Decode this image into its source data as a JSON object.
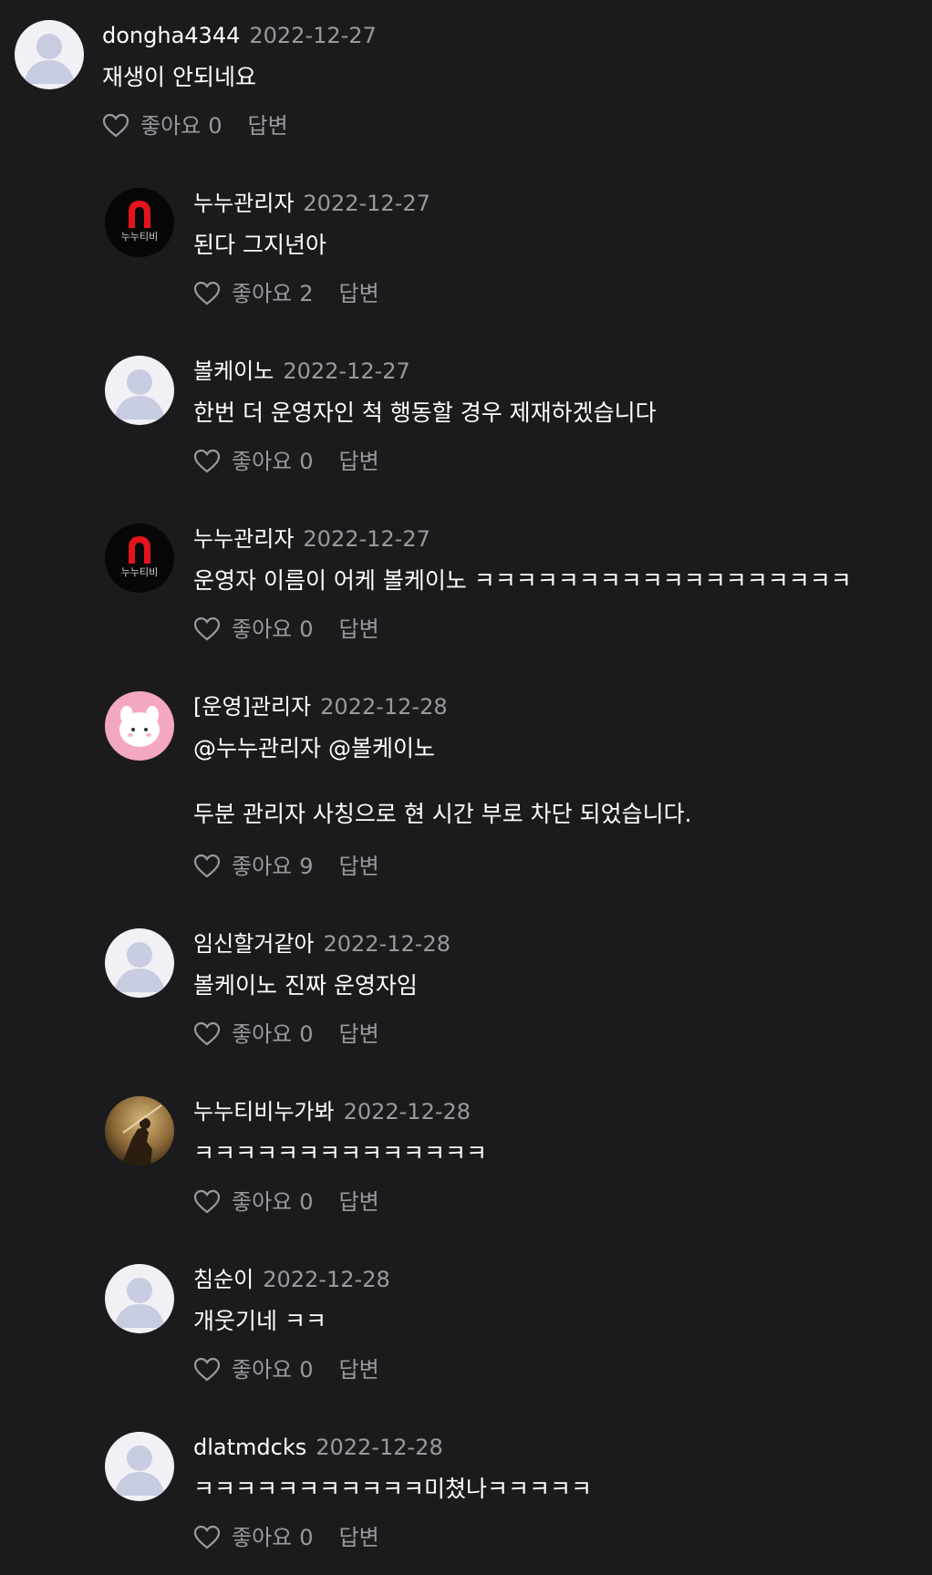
{
  "comments": [
    {
      "author": "dongha4344",
      "date": "2022-12-27",
      "text": "재생이 안되네요",
      "like_label": "좋아요",
      "like_count": "0",
      "reply_label": "답변",
      "avatar": "default-avatar"
    },
    {
      "author": "누누관리자",
      "date": "2022-12-27",
      "text": "된다 그지년아",
      "like_label": "좋아요",
      "like_count": "2",
      "reply_label": "답변",
      "avatar": "nunutv-logo-avatar",
      "logo_text": "누누티비"
    },
    {
      "author": "볼케이노",
      "date": "2022-12-27",
      "text": "한번 더 운영자인 척 행동할 경우 제재하겠습니다",
      "like_label": "좋아요",
      "like_count": "0",
      "reply_label": "답변",
      "avatar": "default-avatar"
    },
    {
      "author": "누누관리자",
      "date": "2022-12-27",
      "text": "운영자 이름이 어케 볼케이노 ㅋㅋㅋㅋㅋㅋㅋㅋㅋㅋㅋㅋㅋㅋㅋㅋㅋㅋ",
      "like_label": "좋아요",
      "like_count": "0",
      "reply_label": "답변",
      "avatar": "nunutv-logo-avatar",
      "logo_text": "누누티비"
    },
    {
      "author": "[운영]관리자",
      "date": "2022-12-28",
      "text": "@누누관리자 @볼케이노\n\n두분 관리자 사칭으로 현 시간 부로 차단 되었습니다.",
      "like_label": "좋아요",
      "like_count": "9",
      "reply_label": "답변",
      "avatar": "bunny-avatar"
    },
    {
      "author": "임신할거같아",
      "date": "2022-12-28",
      "text": "볼케이노 진짜 운영자임",
      "like_label": "좋아요",
      "like_count": "0",
      "reply_label": "답변",
      "avatar": "default-avatar"
    },
    {
      "author": "누누티비누가봐",
      "date": "2022-12-28",
      "text": "ㅋㅋㅋㅋㅋㅋㅋㅋㅋㅋㅋㅋㅋㅋ",
      "like_label": "좋아요",
      "like_count": "0",
      "reply_label": "답변",
      "avatar": "photo-avatar"
    },
    {
      "author": "침순이",
      "date": "2022-12-28",
      "text": "개웃기네 ㅋㅋ",
      "like_label": "좋아요",
      "like_count": "0",
      "reply_label": "답변",
      "avatar": "default-avatar"
    },
    {
      "author": "dlatmdcks",
      "date": "2022-12-28",
      "text": "ㅋㅋㅋㅋㅋㅋㅋㅋㅋㅋㅋ미쳤나ㅋㅋㅋㅋㅋ",
      "like_label": "좋아요",
      "like_count": "0",
      "reply_label": "답변",
      "avatar": "default-avatar"
    }
  ],
  "colors": {
    "background": "#1b1b1d",
    "text": "#ffffff",
    "muted": "#9a9a9e",
    "logo_red": "#e4141b",
    "bunny_pink": "#f4a7c0"
  }
}
